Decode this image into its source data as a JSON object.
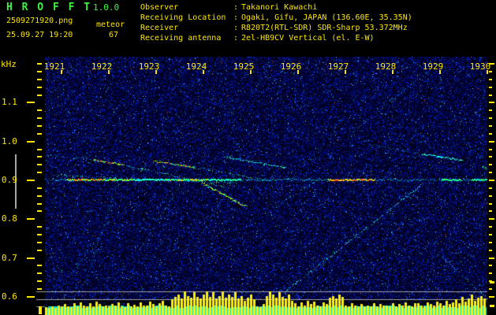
{
  "header": {
    "title": "H R O F F T",
    "version": "1.0.0",
    "filename": "2509271920.png",
    "mode": "meteor",
    "datetime": "25.09.27 19:20",
    "count": "67",
    "colon": ":",
    "info": [
      {
        "label": "Observer",
        "value": "Takanori Kawachi"
      },
      {
        "label": "Receiving Location",
        "value": "Ogaki, Gifu, JAPAN (136.60E, 35.35N)"
      },
      {
        "label": "Receiver",
        "value": "R820T2(RTL-SDR) SDR-Sharp 53.372MHz"
      },
      {
        "label": "Receiving antenna",
        "value": "2el-HB9CV Vertical (el. E-W)"
      }
    ]
  },
  "colors": {
    "title_green": "#3cf53c",
    "text_yellow": "#ffe600",
    "bar_yellow": "#ffef00",
    "bar_cyan": "#00dede",
    "ref_gray": "#a0a0ac",
    "carrier_cyan": "#00c8e8"
  },
  "chart_data": {
    "type": "heatmap",
    "title": "HROFFT meteor echo spectrogram",
    "ylabel": "kHz",
    "x_ticks": [
      "1921",
      "1922",
      "1923",
      "1924",
      "1925",
      "1926",
      "1927",
      "1928",
      "1929",
      "1930"
    ],
    "y_ticks": [
      "1.1",
      "1.0",
      "0.9",
      "0.8",
      "0.7",
      "0.6"
    ],
    "y_minor_step": 0.02,
    "xlim": [
      1920.65,
      1930.0
    ],
    "ylim": [
      0.592,
      1.218
    ],
    "grid": false,
    "carrier_khz": 0.902,
    "level_lines_khz": [
      0.614,
      0.594,
      0.576
    ],
    "carrier_segments": [
      {
        "t": [
          1921.12,
          1921.88
        ],
        "colors": [
          "#ff3018",
          "#ff8000",
          "#ffd000",
          "#60ff40"
        ]
      },
      {
        "t": [
          1921.88,
          1922.5
        ],
        "colors": [
          "#40ff40",
          "#00ffaa",
          "#ffe000"
        ]
      },
      {
        "t": [
          1922.5,
          1923.2
        ],
        "colors": [
          "#00ffff",
          "#40ff80"
        ]
      },
      {
        "t": [
          1923.2,
          1924.1
        ],
        "colors": [
          "#40ff40",
          "#ffd000",
          "#00ffcc"
        ]
      },
      {
        "t": [
          1924.1,
          1924.8
        ],
        "colors": [
          "#00ffcc",
          "#40ff60"
        ]
      },
      {
        "t": [
          1926.63,
          1927.63
        ],
        "colors": [
          "#ff5010",
          "#ffa000",
          "#ffd000",
          "#80ff40"
        ]
      },
      {
        "t": [
          1929.03,
          1929.45
        ],
        "colors": [
          "#40ff60",
          "#00ffaa"
        ]
      },
      {
        "t": [
          1929.67,
          1930.0
        ],
        "colors": [
          "#40ff60",
          "#00ffcc"
        ]
      }
    ],
    "streaks": [
      {
        "t": [
          1921.28,
          1920.7
        ],
        "f": [
          1.218,
          1.101
        ],
        "d": 0.25,
        "colors": [
          "#0070b8"
        ]
      },
      {
        "t": [
          1922.87,
          1921.28
        ],
        "f": [
          1.218,
          0.928
        ],
        "d": 0.22,
        "colors": [
          "#006cb0"
        ]
      },
      {
        "t": [
          1925.37,
          1923.95
        ],
        "f": [
          1.192,
          0.959
        ],
        "d": 0.22,
        "colors": [
          "#006cb0"
        ]
      },
      {
        "t": [
          1927.53,
          1926.28
        ],
        "f": [
          1.172,
          0.949
        ],
        "d": 0.2,
        "colors": [
          "#006cb0"
        ]
      },
      {
        "t": [
          1922.2,
          1921.45
        ],
        "f": [
          0.9,
          0.618
        ],
        "d": 0.3,
        "colors": [
          "#0070c0",
          "#00a0e0"
        ]
      },
      {
        "t": [
          1924.53,
          1923.62
        ],
        "f": [
          0.882,
          0.695
        ],
        "d": 0.3,
        "colors": [
          "#0070c0",
          "#0098e0"
        ]
      },
      {
        "t": [
          1923.58,
          1922.68
        ],
        "f": [
          0.908,
          0.728
        ],
        "d": 0.28,
        "colors": [
          "#0080c8"
        ]
      },
      {
        "t": [
          1922.02,
          1921.05
        ],
        "f": [
          0.797,
          0.634
        ],
        "d": 0.25,
        "colors": [
          "#0078c0"
        ]
      },
      {
        "t": [
          1926.47,
          1925.5
        ],
        "f": [
          0.906,
          0.833
        ],
        "d": 0.45,
        "colors": [
          "#00a0e0",
          "#40c0ff"
        ]
      },
      {
        "t": [
          1927.13,
          1928.78
        ],
        "f": [
          1.024,
          1.186
        ],
        "d": 0.35,
        "colors": [
          "#0080d0",
          "#00b0f0"
        ]
      },
      {
        "t": [
          1928.97,
          1930.0
        ],
        "f": [
          0.711,
          0.596
        ],
        "d": 0.5,
        "colors": [
          "#00b0e8",
          "#40d0ff"
        ]
      },
      {
        "t": [
          1929.5,
          1930.0
        ],
        "f": [
          0.999,
          0.949
        ],
        "d": 0.35,
        "colors": [
          "#0088cc"
        ]
      },
      {
        "t": [
          1920.7,
          1922.2
        ],
        "f": [
          0.967,
          0.945
        ],
        "d": 0.4,
        "colors": [
          "#00a0e0",
          "#00e0ff"
        ]
      },
      {
        "t": [
          1920.8,
          1924.7
        ],
        "f": [
          0.914,
          0.894
        ],
        "d": 0.5,
        "colors": [
          "#00c0e8",
          "#40ffa0"
        ]
      },
      {
        "t": [
          1925.7,
          1928.6
        ],
        "f": [
          0.612,
          0.89
        ],
        "d": 0.65,
        "colors": [
          "#00d0ff",
          "#00ffff",
          "#60c0ff"
        ]
      },
      {
        "t": [
          1927.4,
          1928.6
        ],
        "f": [
          0.995,
          0.968
        ],
        "d": 0.35,
        "colors": [
          "#0090d0"
        ]
      },
      {
        "t": [
          1921.67,
          1922.3
        ],
        "f": [
          0.953,
          0.94
        ],
        "d": 0.95,
        "colors": [
          "#ff4020",
          "#ffc000",
          "#40ff40"
        ]
      },
      {
        "t": [
          1922.3,
          1924.45
        ],
        "f": [
          0.94,
          0.884
        ],
        "d": 0.6,
        "colors": [
          "#30ff50",
          "#00e0ff",
          "#00b0ff"
        ]
      },
      {
        "t": [
          1922.95,
          1923.8
        ],
        "f": [
          0.951,
          0.934
        ],
        "d": 0.9,
        "colors": [
          "#40ff40",
          "#ff4020",
          "#ffd000",
          "#00ffcc"
        ]
      },
      {
        "t": [
          1923.8,
          1925.4
        ],
        "f": [
          0.934,
          0.9
        ],
        "d": 0.55,
        "colors": [
          "#00e0ff",
          "#40ff80"
        ]
      },
      {
        "t": [
          1924.45,
          1925.7
        ],
        "f": [
          0.961,
          0.934
        ],
        "d": 0.8,
        "colors": [
          "#00ffff",
          "#40ffa0",
          "#00c0ff"
        ]
      },
      {
        "t": [
          1923.98,
          1924.9
        ],
        "f": [
          0.892,
          0.833
        ],
        "d": 0.95,
        "colors": [
          "#40ff40",
          "#a0ff20",
          "#ffe000",
          "#00ffaa"
        ]
      },
      {
        "t": [
          1928.6,
          1929.45
        ],
        "f": [
          0.968,
          0.953
        ],
        "d": 0.9,
        "colors": [
          "#00ffff",
          "#40ffc0"
        ]
      },
      {
        "t": [
          1929.9,
          1930.05
        ],
        "f": [
          0.936,
          0.926
        ],
        "d": 0.9,
        "colors": [
          "#40ff60",
          "#00ffcc"
        ]
      }
    ],
    "bar_levels": [
      0.25,
      0.2,
      0.3,
      0.22,
      0.35,
      0.28,
      0.4,
      0.3,
      0.25,
      0.45,
      0.3,
      0.5,
      0.35,
      0.28,
      0.45,
      0.3,
      0.55,
      0.4,
      0.3,
      0.35,
      0.28,
      0.4,
      0.32,
      0.5,
      0.3,
      0.26,
      0.45,
      0.3,
      0.38,
      0.3,
      0.5,
      0.35,
      0.35,
      0.55,
      0.4,
      0.3,
      0.45,
      0.6,
      0.35,
      0.3,
      0.65,
      0.8,
      0.9,
      0.7,
      1,
      0.85,
      0.75,
      0.95,
      0.8,
      0.7,
      0.9,
      1,
      0.8,
      0.95,
      0.7,
      0.85,
      1,
      0.75,
      0.9,
      0.8,
      0.95,
      0.7,
      0.85,
      0.6,
      0.75,
      0.9,
      0.65,
      0.3,
      0.25,
      0.4,
      0.85,
      1,
      0.9,
      0.75,
      0.95,
      0.8,
      0.7,
      0.9,
      0.6,
      0.45,
      0.3,
      0.5,
      0.35,
      0.6,
      0.4,
      0.55,
      0.35,
      0.3,
      0.5,
      0.4,
      0.75,
      0.85,
      0.7,
      0.9,
      0.8,
      0.35,
      0.3,
      0.45,
      0.35,
      0.3,
      0.4,
      0.3,
      0.35,
      0.28,
      0.45,
      0.3,
      0.4,
      0.35,
      0.35,
      0.3,
      0.45,
      0.3,
      0.4,
      0.32,
      0.5,
      0.35,
      0.3,
      0.45,
      0.45,
      0.35,
      0.3,
      0.5,
      0.4,
      0.35,
      0.55,
      0.45,
      0.35,
      0.6,
      0.4,
      0.5,
      0.65,
      0.45,
      0.8,
      0.55,
      0.7,
      0.9,
      0.6,
      0.75,
      0.85,
      0.7
    ]
  }
}
